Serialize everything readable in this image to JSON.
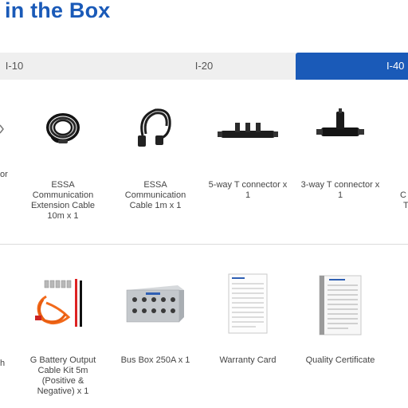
{
  "page": {
    "title": "in the Box"
  },
  "tabs": [
    {
      "label": "I-10",
      "active": false
    },
    {
      "label": "I-20",
      "active": false
    },
    {
      "label": "I-40",
      "active": true
    }
  ],
  "colors": {
    "accent": "#1a5ab8",
    "tab_bg": "#efefef",
    "text": "#444444"
  },
  "row1": {
    "left_edge_text": "or",
    "right_edge_text": [
      "C",
      "T"
    ],
    "items": [
      {
        "icon": "coiled-cable-icon",
        "caption": [
          "ESSA",
          "Communication",
          "Extension Cable",
          "10m x 1"
        ]
      },
      {
        "icon": "coiled-cable-short-icon",
        "caption": [
          "ESSA",
          "Communication",
          "Cable 1m x 1"
        ]
      },
      {
        "icon": "five-way-connector-icon",
        "caption": [
          "5-way T connector x",
          "1"
        ]
      },
      {
        "icon": "three-way-connector-icon",
        "caption": [
          "3-way T connector x",
          "1"
        ]
      }
    ]
  },
  "row2": {
    "left_edge_text": "h",
    "items": [
      {
        "icon": "battery-cable-kit-icon",
        "caption": [
          "G Battery Output",
          "Cable Kit 5m",
          "(Positive &",
          "Negative) x 1"
        ]
      },
      {
        "icon": "bus-box-icon",
        "caption": [
          "Bus Box 250A x 1"
        ]
      },
      {
        "icon": "warranty-card-icon",
        "caption": [
          "Warranty Card"
        ]
      },
      {
        "icon": "quality-certificate-icon",
        "caption": [
          "Quality Certificate"
        ]
      }
    ]
  }
}
